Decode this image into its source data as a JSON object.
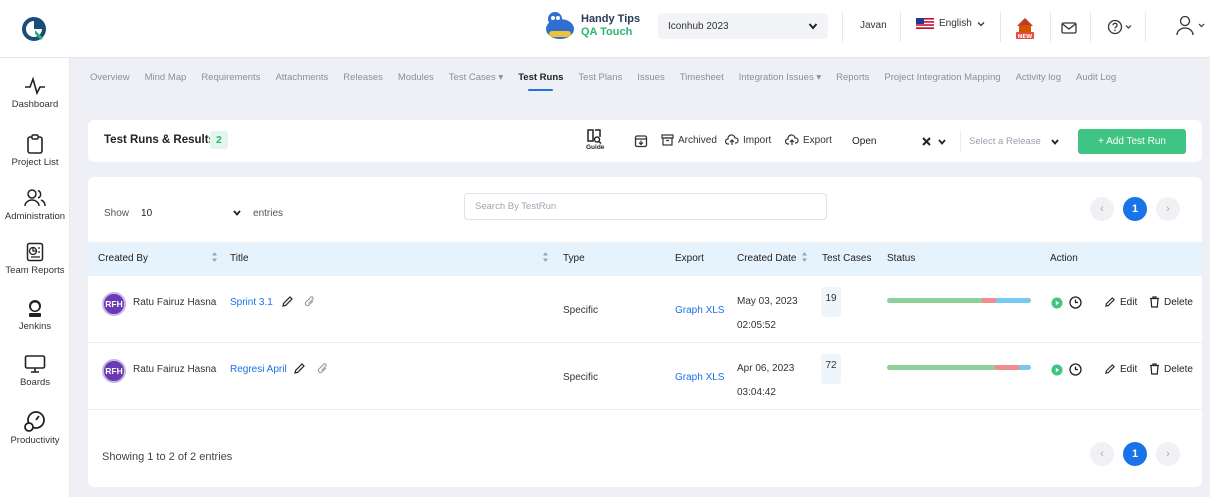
{
  "topbar": {
    "handy_title": "Handy Tips",
    "handy_sub": "QA Touch",
    "project": "Iconhub 2023",
    "user": "Javan",
    "language": "English"
  },
  "sidebar": [
    {
      "label": "Dashboard",
      "icon": "pulse-icon"
    },
    {
      "label": "Project List",
      "icon": "clipboard-icon"
    },
    {
      "label": "Administration",
      "icon": "users-icon"
    },
    {
      "label": "Team Reports",
      "icon": "report-icon"
    },
    {
      "label": "Jenkins",
      "icon": "jenkins-icon"
    },
    {
      "label": "Boards",
      "icon": "board-icon"
    },
    {
      "label": "Productivity",
      "icon": "gauge-icon"
    }
  ],
  "tabs": [
    "Overview",
    "Mind Map",
    "Requirements",
    "Attachments",
    "Releases",
    "Modules",
    "Test Cases ▾",
    "Test Runs",
    "Test Plans",
    "Issues",
    "Timesheet",
    "Integration Issues ▾",
    "Reports",
    "Project Integration Mapping",
    "Activity log",
    "Audit Log"
  ],
  "active_tab": "Test Runs",
  "header": {
    "title": "Test Runs & Results",
    "count": "2",
    "guide": "Guide",
    "archived": "Archived",
    "import": "Import",
    "export": "Export",
    "status_filter": "Open",
    "release_placeholder": "Select a Release",
    "add_button": "+ Add Test Run"
  },
  "table": {
    "show_label": "Show",
    "entries_value": "10",
    "entries_label": "entries",
    "search_placeholder": "Search By TestRun",
    "page": "1",
    "columns": [
      "Created By",
      "Title",
      "Type",
      "Export",
      "Created Date",
      "Test Cases",
      "Status",
      "Action"
    ],
    "rows": [
      {
        "initials": "RFH",
        "creator": "Ratu Fairuz Hasna",
        "title": "Sprint 3.1",
        "type": "Specific",
        "export": "Graph XLS",
        "date": "May 03, 2023",
        "time": "02:05:52",
        "cases": "19",
        "status": {
          "passed": 0.66,
          "failed": 0.1,
          "untested": 0.24
        }
      },
      {
        "initials": "RFH",
        "creator": "Ratu Fairuz Hasna",
        "title": "Regresi April",
        "type": "Specific",
        "export": "Graph XLS",
        "date": "Apr 06, 2023",
        "time": "03:04:42",
        "cases": "72",
        "status": {
          "passed": 0.75,
          "failed": 0.17,
          "untested": 0.08
        }
      }
    ],
    "edit_label": "Edit",
    "delete_label": "Delete",
    "footer": "Showing 1 to 2 of 2 entries"
  },
  "colors": {
    "accent": "#1a73e8",
    "green": "#3fc483",
    "passed": "#8fcf9a",
    "failed": "#f08d8d",
    "untested": "#79c8f2"
  }
}
